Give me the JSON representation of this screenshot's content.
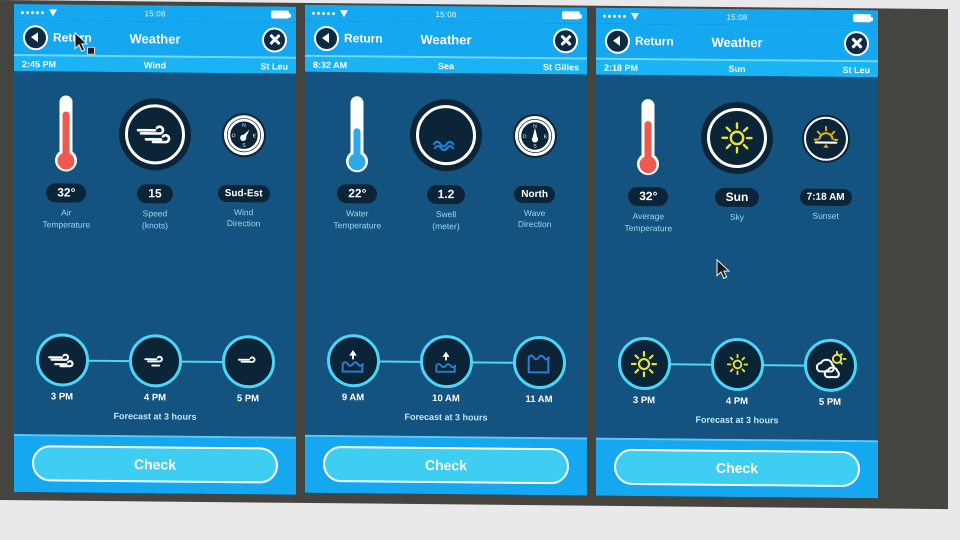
{
  "desktop": {
    "background": "#e9e9ec",
    "bezel_color": "#46443f"
  },
  "common": {
    "nav_back_label": "Return",
    "nav_title": "Weather",
    "forecast_caption": "Forecast at 3 hours",
    "check_label": "Check",
    "status_time": "15:08"
  },
  "colors": {
    "header_blue": "#15a7ef",
    "subbar_blue": "#1ab4f5",
    "body_blue": "#14537f",
    "pill_dark": "#0c2438",
    "accent_cyan": "#49d6f7",
    "caption_blue": "#9fd6f0",
    "hot_red": "#ee5a4f",
    "cool_blue": "#2fa8e8",
    "sun_yellow": "#e8e23c",
    "sunset_gold": "#d8a117"
  },
  "panels": [
    {
      "id": "wind",
      "sub_time": "2:45 PM",
      "sub_mode": "Wind",
      "sub_place": "St Leu",
      "metrics": [
        {
          "icon": "thermometer-hot-icon",
          "value": "32°",
          "caption": "Air\nTemperature"
        },
        {
          "icon": "wind-icon",
          "value": "15",
          "caption": "Speed\n(knots)"
        },
        {
          "icon": "compass-icon",
          "value": "Sud-Est",
          "caption": "Wind\nDirection"
        }
      ],
      "forecast": [
        {
          "icon": "wind-icon",
          "label": "3 PM"
        },
        {
          "icon": "wind-icon",
          "label": "4 PM"
        },
        {
          "icon": "wind-icon",
          "label": "5 PM"
        }
      ]
    },
    {
      "id": "sea",
      "sub_time": "8:32 AM",
      "sub_mode": "Sea",
      "sub_place": "St Gilles",
      "metrics": [
        {
          "icon": "thermometer-cold-icon",
          "value": "22°",
          "caption": "Water\nTemperature"
        },
        {
          "icon": "swell-icon",
          "value": "1.2",
          "caption": "Swell\n(meter)"
        },
        {
          "icon": "compass-icon",
          "value": "North",
          "caption": "Wave\nDirection"
        }
      ],
      "forecast": [
        {
          "icon": "wave-rising-icon",
          "label": "9 AM"
        },
        {
          "icon": "wave-rising-icon",
          "label": "10 AM"
        },
        {
          "icon": "wave-high-icon",
          "label": "11 AM"
        }
      ]
    },
    {
      "id": "sun",
      "sub_time": "2:18 PM",
      "sub_mode": "Sun",
      "sub_place": "St Leu",
      "metrics": [
        {
          "icon": "thermometer-hot-icon",
          "value": "32°",
          "caption": "Average\nTemperature"
        },
        {
          "icon": "sun-icon",
          "value": "Sun",
          "caption": "Sky"
        },
        {
          "icon": "sunset-icon",
          "value": "7:18 AM",
          "caption": "Sunset"
        }
      ],
      "forecast": [
        {
          "icon": "sun-icon",
          "label": "3 PM"
        },
        {
          "icon": "sun-icon",
          "label": "4 PM"
        },
        {
          "icon": "cloud-sun-icon",
          "label": "5 PM"
        }
      ]
    }
  ]
}
